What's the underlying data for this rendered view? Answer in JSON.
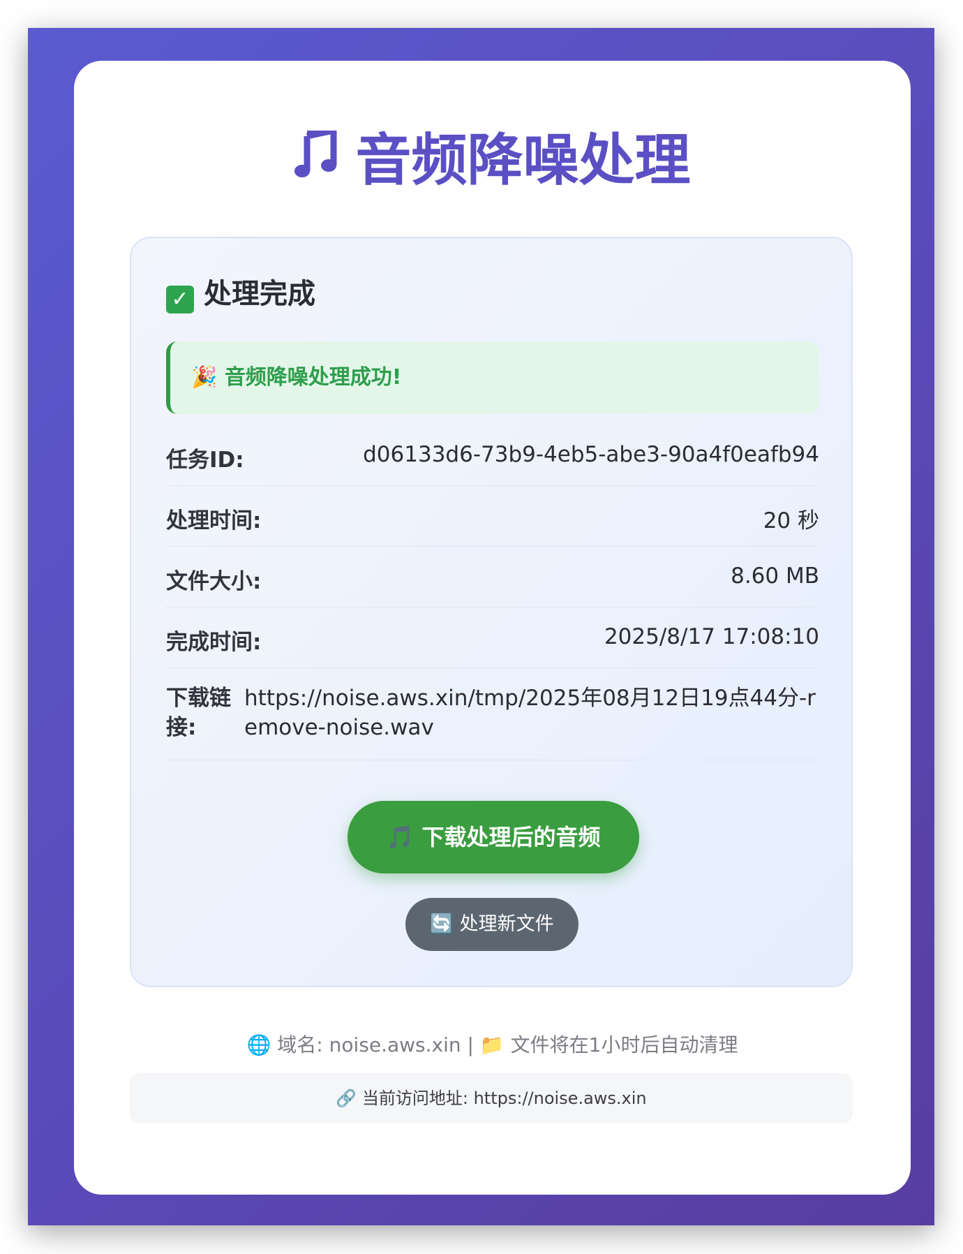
{
  "header": {
    "icon": "music-note-icon",
    "title": "音频降噪处理"
  },
  "result": {
    "icon": "check-icon",
    "heading": "处理完成",
    "success_icon": "party-popper-icon",
    "success_message": "音频降噪处理成功!"
  },
  "details": {
    "task_id_label": "任务ID:",
    "task_id_value": "d06133d6-73b9-4eb5-abe3-90a4f0eafb94",
    "time_label": "处理时间:",
    "time_value": "20 秒",
    "size_label": "文件大小:",
    "size_value": "8.60 MB",
    "completed_label": "完成时间:",
    "completed_value": "2025/8/17 17:08:10",
    "link_label": "下载链接:",
    "link_value": "https://noise.aws.xin/tmp/2025年08月12日19点44分-remove-noise.wav"
  },
  "actions": {
    "download_label": "下载处理后的音频",
    "new_file_label": "处理新文件"
  },
  "footer": {
    "domain_text": "域名: noise.aws.xin",
    "separator": "|",
    "cleanup_text": "文件将在1小时后自动清理",
    "visit_text": "当前访问地址: https://noise.aws.xin"
  },
  "colors": {
    "background_gradient_start": "#5a5bd0",
    "background_gradient_end": "#573d9f",
    "title": "#5b4fc4",
    "success_green": "#2e9e4c",
    "download_button": "#3a9d3f",
    "secondary_button": "#5c6670"
  }
}
